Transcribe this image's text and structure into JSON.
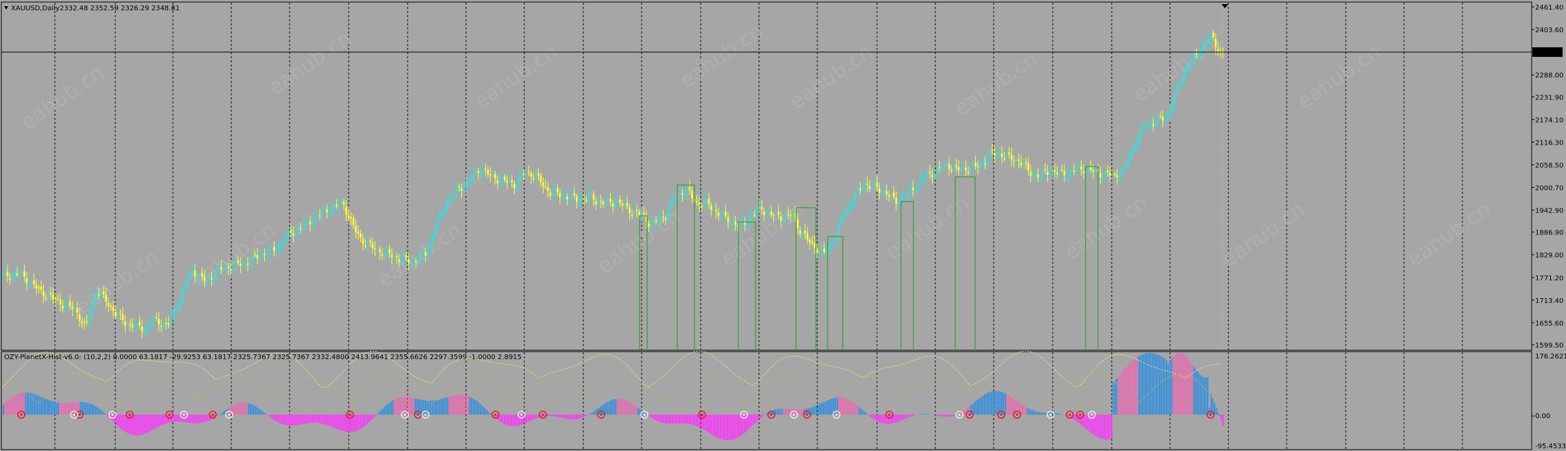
{
  "colors": {
    "background": "#a6a6a6",
    "bull_candle": "#33e0e0",
    "bear_candle": "#ffff33",
    "grid": "#000000",
    "hist_blue": "#2f8fe0",
    "hist_magenta": "#ff33ff",
    "hist_pink": "#e86ab0",
    "signal_line": "#f2f26a",
    "rect": "#2fa02f",
    "sell_arrow": "#e02020",
    "buy_arrow": "#e8e8e8"
  },
  "main_panel": {
    "title": "XAUUSD,Daily",
    "ohlc": "2332.48 2352.59 2326.29 2348.81",
    "current_price_label": "2348.81",
    "price_ticks": [
      "2461.40",
      "2403.60",
      "2348.81",
      "2288.00",
      "2231.90",
      "2174.10",
      "2116.30",
      "2058.50",
      "2000.70",
      "1942.90",
      "1886.90",
      "1829.00",
      "1771.20",
      "1713.40",
      "1655.60",
      "1599.50"
    ],
    "watermark": "eahub.cn"
  },
  "indicator_panel": {
    "title": "OZY-PlanetX-Hist-v6.0: (10,2,2) 0.0000 63.1817 -29.9253 63.1817 2325.7367 2325.7367 2332.4800 2413.9641 2355.6626 2297.3599 -1.0000 2.8915",
    "scale_ticks": [
      "176.2621",
      "0.00",
      "-95.4533"
    ]
  },
  "chart_data": {
    "type": "candlestick",
    "symbol": "XAUUSD",
    "timeframe": "Daily",
    "ylim": [
      1599.5,
      2461.4
    ],
    "current": 2348.81,
    "approx_close_path": [
      [
        0,
        1775
      ],
      [
        30,
        1780
      ],
      [
        60,
        1735
      ],
      [
        90,
        1705
      ],
      [
        110,
        1690
      ],
      [
        125,
        1640
      ],
      [
        140,
        1740
      ],
      [
        155,
        1710
      ],
      [
        175,
        1665
      ],
      [
        190,
        1650
      ],
      [
        210,
        1640
      ],
      [
        225,
        1660
      ],
      [
        245,
        1650
      ],
      [
        265,
        1730
      ],
      [
        280,
        1790
      ],
      [
        300,
        1760
      ],
      [
        320,
        1790
      ],
      [
        340,
        1800
      ],
      [
        360,
        1810
      ],
      [
        380,
        1830
      ],
      [
        400,
        1840
      ],
      [
        420,
        1880
      ],
      [
        440,
        1900
      ],
      [
        460,
        1925
      ],
      [
        480,
        1945
      ],
      [
        500,
        1960
      ],
      [
        515,
        1900
      ],
      [
        525,
        1870
      ],
      [
        545,
        1845
      ],
      [
        560,
        1835
      ],
      [
        580,
        1820
      ],
      [
        600,
        1810
      ],
      [
        620,
        1830
      ],
      [
        635,
        1900
      ],
      [
        650,
        1960
      ],
      [
        665,
        1990
      ],
      [
        685,
        2020
      ],
      [
        700,
        2050
      ],
      [
        715,
        2030
      ],
      [
        730,
        2020
      ],
      [
        750,
        2010
      ],
      [
        765,
        2040
      ],
      [
        780,
        2030
      ],
      [
        800,
        1990
      ],
      [
        820,
        1980
      ],
      [
        840,
        1970
      ],
      [
        860,
        1975
      ],
      [
        880,
        1960
      ],
      [
        900,
        1965
      ],
      [
        920,
        1940
      ],
      [
        935,
        1930
      ],
      [
        950,
        1905
      ],
      [
        970,
        1930
      ],
      [
        985,
        1980
      ],
      [
        1000,
        1995
      ],
      [
        1015,
        1960
      ],
      [
        1030,
        1960
      ],
      [
        1050,
        1930
      ],
      [
        1065,
        1915
      ],
      [
        1080,
        1900
      ],
      [
        1095,
        1930
      ],
      [
        1110,
        1945
      ],
      [
        1125,
        1930
      ],
      [
        1140,
        1925
      ],
      [
        1155,
        1930
      ],
      [
        1165,
        1895
      ],
      [
        1180,
        1860
      ],
      [
        1200,
        1830
      ],
      [
        1215,
        1870
      ],
      [
        1230,
        1935
      ],
      [
        1245,
        1975
      ],
      [
        1260,
        2010
      ],
      [
        1275,
        2000
      ],
      [
        1290,
        1990
      ],
      [
        1305,
        1965
      ],
      [
        1320,
        1980
      ],
      [
        1335,
        2005
      ],
      [
        1350,
        2030
      ],
      [
        1365,
        2045
      ],
      [
        1380,
        2060
      ],
      [
        1395,
        2045
      ],
      [
        1410,
        2050
      ],
      [
        1425,
        2055
      ],
      [
        1440,
        2080
      ],
      [
        1455,
        2090
      ],
      [
        1470,
        2075
      ],
      [
        1485,
        2070
      ],
      [
        1500,
        2040
      ],
      [
        1515,
        2030
      ],
      [
        1530,
        2045
      ],
      [
        1545,
        2035
      ],
      [
        1560,
        2040
      ],
      [
        1580,
        2050
      ],
      [
        1595,
        2040
      ],
      [
        1610,
        2035
      ],
      [
        1625,
        2030
      ],
      [
        1640,
        2050
      ],
      [
        1655,
        2120
      ],
      [
        1670,
        2160
      ],
      [
        1685,
        2170
      ],
      [
        1700,
        2180
      ],
      [
        1715,
        2250
      ],
      [
        1730,
        2310
      ],
      [
        1745,
        2340
      ],
      [
        1755,
        2370
      ],
      [
        1765,
        2385
      ],
      [
        1780,
        2340
      ],
      [
        1790,
        2348
      ]
    ]
  }
}
